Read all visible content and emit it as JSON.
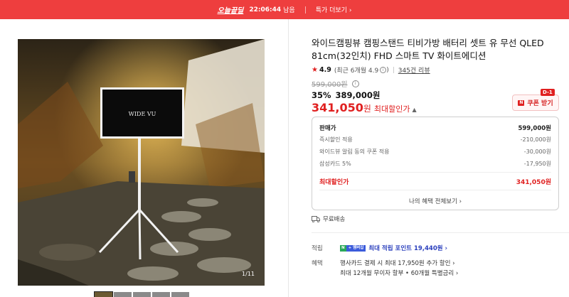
{
  "banner": {
    "deal_label": "오늘끝딜",
    "timer": "22:06:44",
    "timer_suffix": "남음",
    "more_label": "특가 더보기 ›"
  },
  "gallery": {
    "tv_brand": "WIDE VU",
    "counter": "1/11",
    "thumb_count": 5
  },
  "product": {
    "title": "와이드캠핑뷰 캠핑스탠드 티비가방 배터리 셋트 유 무선 QLED 81cm(32인치) FHD 스마트 TV 화이트에디션",
    "rating": "4.9",
    "recent_rating_label": "(최근 6개월 4.9",
    "recent_rating_close": ")",
    "review_count": "345건 리뷰",
    "original_price": "599,000원",
    "discount_pct": "35%",
    "discount_price": "389,000원",
    "final_price": "341,050",
    "final_unit": "원",
    "final_label": "최대할인가",
    "coupon_label": "쿠폰 받기",
    "coupon_badge": "D-1"
  },
  "breakdown": {
    "rows": [
      {
        "label": "판매가",
        "value": "599,000원"
      },
      {
        "label": "즉시할인 적용",
        "value": "-210,000원"
      },
      {
        "label": "와이드뷰 알림 동의 쿠폰 적용",
        "value": "-30,000원"
      },
      {
        "label": "삼성카드 5%",
        "value": "-17,950원"
      }
    ],
    "total_label": "최대할인가",
    "total_value": "341,050원",
    "link_label": "나의 혜택 전체보기 ›"
  },
  "shipping": {
    "label": "무료배송"
  },
  "points": {
    "label": "적립",
    "badge_n": "N",
    "badge_text": "+ 멤버십",
    "text": "최대 적립 포인트 19,440원 ›"
  },
  "benefits": {
    "label": "혜택",
    "items": [
      "행사카드 결제 시 최대 17,950원 추가 할인 ›",
      "최대 12개월 무이자 할부 • 60개월 특별금리 ›"
    ]
  },
  "colors": {
    "accent": "#e02020",
    "banner": "#ee3e3e",
    "points": "#2a3fbd"
  }
}
